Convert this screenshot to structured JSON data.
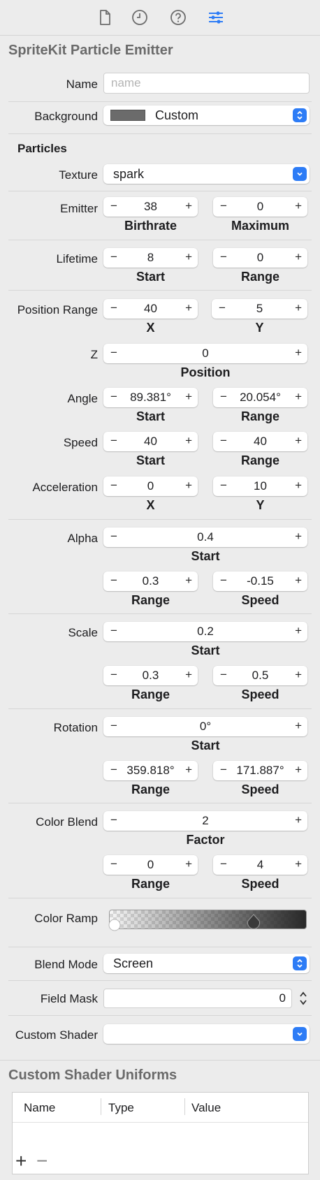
{
  "toolbar": {
    "icons": [
      "file-icon",
      "history-icon",
      "help-icon",
      "attributes-icon"
    ],
    "active_color": "#2d7cf6"
  },
  "header": {
    "title": "SpriteKit Particle Emitter"
  },
  "name_field": {
    "label": "Name",
    "placeholder": "name",
    "value": ""
  },
  "background": {
    "label": "Background",
    "value": "Custom",
    "swatch": "#6b6b6b"
  },
  "particles": {
    "title": "Particles",
    "texture": {
      "label": "Texture",
      "value": "spark"
    }
  },
  "emitter": {
    "label": "Emitter",
    "birthrate": "38",
    "maximum": "0",
    "cap1": "Birthrate",
    "cap2": "Maximum"
  },
  "lifetime": {
    "label": "Lifetime",
    "start": "8",
    "range": "0",
    "cap1": "Start",
    "cap2": "Range"
  },
  "position_range": {
    "label": "Position Range",
    "x": "40",
    "y": "5",
    "cap1": "X",
    "cap2": "Y"
  },
  "z": {
    "label": "Z",
    "value": "0",
    "cap": "Position"
  },
  "angle": {
    "label": "Angle",
    "start": "89.381°",
    "range": "20.054°",
    "cap1": "Start",
    "cap2": "Range"
  },
  "speed": {
    "label": "Speed",
    "start": "40",
    "range": "40",
    "cap1": "Start",
    "cap2": "Range"
  },
  "acceleration": {
    "label": "Acceleration",
    "x": "0",
    "y": "10",
    "cap1": "X",
    "cap2": "Y"
  },
  "alpha": {
    "label": "Alpha",
    "start": "0.4",
    "start_cap": "Start",
    "range": "0.3",
    "speed": "-0.15",
    "cap1": "Range",
    "cap2": "Speed"
  },
  "scale": {
    "label": "Scale",
    "start": "0.2",
    "start_cap": "Start",
    "range": "0.3",
    "speed": "0.5",
    "cap1": "Range",
    "cap2": "Speed"
  },
  "rotation": {
    "label": "Rotation",
    "start": "0°",
    "start_cap": "Start",
    "range": "359.818°",
    "speed": "171.887°",
    "cap1": "Range",
    "cap2": "Speed"
  },
  "color_blend": {
    "label": "Color Blend",
    "factor": "2",
    "factor_cap": "Factor",
    "range": "0",
    "speed": "4",
    "cap1": "Range",
    "cap2": "Speed"
  },
  "color_ramp": {
    "label": "Color Ramp"
  },
  "blend_mode": {
    "label": "Blend Mode",
    "value": "Screen"
  },
  "field_mask": {
    "label": "Field Mask",
    "value": "0"
  },
  "custom_shader": {
    "label": "Custom Shader",
    "value": ""
  },
  "uniforms": {
    "title": "Custom Shader Uniforms",
    "columns": [
      "Name",
      "Type",
      "Value"
    ],
    "add": "+",
    "remove": "−"
  },
  "stepper_minus": "−",
  "stepper_plus": "+"
}
